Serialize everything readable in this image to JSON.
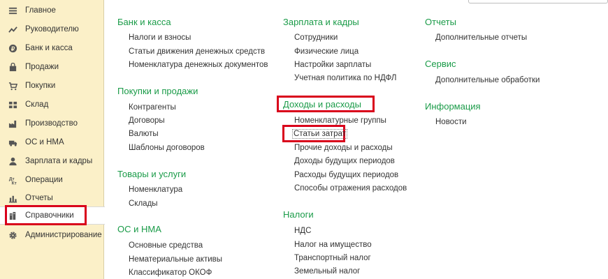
{
  "search": {
    "placeholder": ""
  },
  "sidebar": {
    "items": [
      {
        "label": "Главное",
        "icon": "menu-lines-icon"
      },
      {
        "label": "Руководителю",
        "icon": "trend-chart-icon"
      },
      {
        "label": "Банк и касса",
        "icon": "ruble-coin-icon"
      },
      {
        "label": "Продажи",
        "icon": "shopping-bag-icon"
      },
      {
        "label": "Покупки",
        "icon": "shopping-cart-icon"
      },
      {
        "label": "Склад",
        "icon": "warehouse-grid-icon"
      },
      {
        "label": "Производство",
        "icon": "factory-icon"
      },
      {
        "label": "ОС и НМА",
        "icon": "truck-icon"
      },
      {
        "label": "Зарплата и кадры",
        "icon": "person-icon"
      },
      {
        "label": "Операции",
        "icon": "operations-icon"
      },
      {
        "label": "Отчеты",
        "icon": "bar-chart-icon"
      },
      {
        "label": "Справочники",
        "icon": "books-icon"
      },
      {
        "label": "Администрирование",
        "icon": "gear-icon"
      }
    ]
  },
  "columns": [
    {
      "sections": [
        {
          "title": "Банк и касса",
          "links": [
            "Налоги и взносы",
            "Статьи движения денежных средств",
            "Номенклатура денежных документов"
          ]
        },
        {
          "title": "Покупки и продажи",
          "links": [
            "Контрагенты",
            "Договоры",
            "Валюты",
            "Шаблоны договоров"
          ]
        },
        {
          "title": "Товары и услуги",
          "links": [
            "Номенклатура",
            "Склады"
          ]
        },
        {
          "title": "ОС и НМА",
          "links": [
            "Основные средства",
            "Нематериальные активы",
            "Классификатор ОКОФ"
          ]
        }
      ]
    },
    {
      "sections": [
        {
          "title": "Зарплата и кадры",
          "links": [
            "Сотрудники",
            "Физические лица",
            "Настройки зарплаты",
            "Учетная политика по НДФЛ"
          ]
        },
        {
          "title": "Доходы и расходы",
          "links": [
            "Номенклатурные группы",
            "Статьи затрат",
            "Прочие доходы и расходы",
            "Доходы будущих периодов",
            "Расходы будущих периодов",
            "Способы отражения расходов"
          ]
        },
        {
          "title": "Налоги",
          "links": [
            "НДС",
            "Налог на имущество",
            "Транспортный налог",
            "Земельный налог"
          ]
        }
      ]
    },
    {
      "sections": [
        {
          "title": "Отчеты",
          "links": [
            "Дополнительные отчеты"
          ]
        },
        {
          "title": "Сервис",
          "links": [
            "Дополнительные обработки"
          ]
        },
        {
          "title": "Информация",
          "links": [
            "Новости"
          ]
        }
      ]
    }
  ],
  "colors": {
    "section_title": "#1a9b48",
    "sidebar_bg": "#fbf0c8",
    "highlight_red": "#d9001b"
  }
}
